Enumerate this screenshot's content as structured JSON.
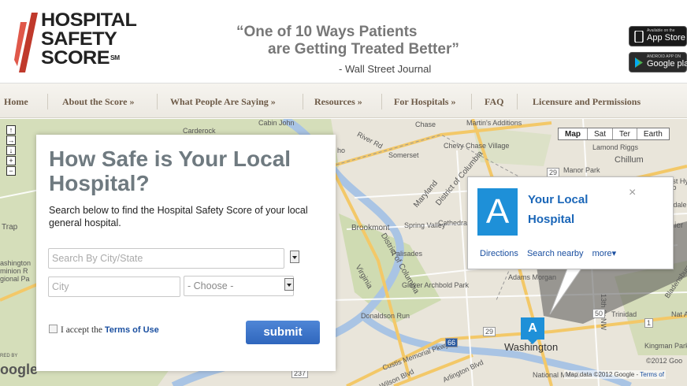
{
  "logo": {
    "line1": "HOSPITAL",
    "line2": "SAFETY",
    "line3": "SCORE",
    "mark": "SM"
  },
  "quote": {
    "line1": "“One of 10 Ways Patients",
    "line2": "are Getting Treated Better”",
    "source": "- Wall Street Journal"
  },
  "stores": {
    "appstore": {
      "small": "Available on the",
      "big": "App Store"
    },
    "googleplay": {
      "small": "ANDROID APP ON",
      "big": "Google play"
    }
  },
  "nav": [
    "Home",
    "About the Score »",
    "What People Are Saying »",
    "Resources »",
    "For Hospitals »",
    "FAQ",
    "Licensure and Permissions"
  ],
  "panel": {
    "title": "How Safe is Your Local Hospital?",
    "description": "Search below to find the Hospital Safety Score of your local general hospital.",
    "citystate_placeholder": "Search By City/State",
    "city_placeholder": "City",
    "state_select": "- Choose -",
    "accept_text": "I accept the ",
    "terms_link": "Terms of Use",
    "submit": "submit"
  },
  "infowindow": {
    "letter": "A",
    "title": "Your Local Hospital",
    "close": "×",
    "links": [
      "Directions",
      "Search nearby",
      "more▾"
    ]
  },
  "marker": "A",
  "map": {
    "types": [
      "Map",
      "Sat",
      "Ter",
      "Earth"
    ],
    "labels": {
      "cabin_john": "Cabin John",
      "carderock": "Carderock",
      "chase": "Chase",
      "martins_additions": "Martin's Additions",
      "chevy_chase_village": "Chevy Chase Village",
      "somerset": "Somerset",
      "park": "Park",
      "lamond_riggs": "Lamond Riggs",
      "chillum": "Chillum",
      "manor_park": "Manor Park",
      "west_hyattsville": "West Hyattsville",
      "riverdale": "vondale",
      "mt_rainier": "t Rainier",
      "brookmont": "Brookmont",
      "spring_valley": "Spring Valley",
      "cathedral_heights": "Cathedral Heights",
      "palisades": "Palisades",
      "glover_archbold": "Glover Archbold Park",
      "adams_morgan": "Adams Morgan",
      "donaldson_run": "Donaldson Run",
      "washington": "Washington",
      "kingman_park": "Kingman Park",
      "trinidad": "Trinidad",
      "national_arbor": "Nat Arbor",
      "trap": "Trap",
      "arlington_side": "ashington minion R gional Pa",
      "maryland": "Maryland",
      "district_columbia": "District of Columbia",
      "virginia": "Virginia",
      "river_rd": "River Rd",
      "ho": "ho",
      "custis_pkwy": "Custis Memorial Pkwy",
      "wilson_blvd": "Wilson Blvd",
      "arlington_blvd": "Arlington Blvd",
      "n_st": "13th St NW",
      "national_mall": "National Mall &",
      "earth_lbl": "Co",
      "route_237": "237",
      "route_29": "29",
      "route_50": "50",
      "route_66": "66",
      "route_1": "1",
      "red_by": "RED BY",
      "bladensburg": "Bladensburg Rd",
      "nbsp": ""
    },
    "copyright": "Map data ©2012 Google - ",
    "terms": "Terms of",
    "google_year": "©2012 Goo",
    "google_logo": "oogle"
  },
  "colors": {
    "accent_blue": "#1e90d8",
    "logo_red": "#c0392b",
    "nav_text": "#6d5a47",
    "submit_blue": "#3a72c8"
  }
}
